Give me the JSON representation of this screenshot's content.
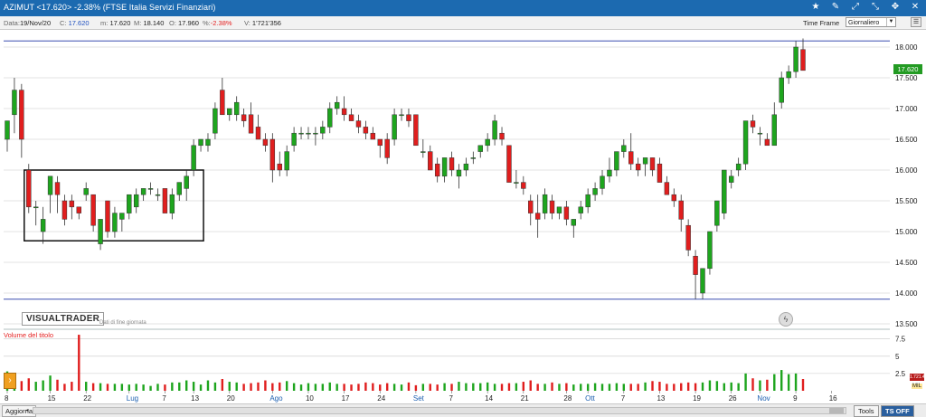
{
  "window": {
    "title": "AZIMUT <17.620> -2.38%  (FTSE Italia Servizi Finanziari)",
    "icons": [
      "star-icon",
      "settings-icon",
      "expand-icon",
      "collapse-icon",
      "move-icon",
      "close-icon"
    ]
  },
  "quote": {
    "date_label": "Data:",
    "date": "19/Nov/20",
    "close_label": "C:",
    "close": "17.620",
    "min_label": "m:",
    "min": "17.620",
    "max_label": "M:",
    "max": "18.140",
    "open_label": "O:",
    "open": "17.960",
    "pct_label": "%:",
    "pct": "-2.38%",
    "vol_label": "V:",
    "vol": "1'721'356"
  },
  "timeframe": {
    "label": "Time Frame",
    "value": "Giornaliero",
    "icon": "menu-icon"
  },
  "chart": {
    "watermark": "VISUALTRADER",
    "watermark_sub": "Dati di fine giornata",
    "volume_label": "Volume del titolo",
    "price_tag": "17.620",
    "vol_tag": "1.721.4",
    "vol_unit": "MIL",
    "flash_icon": "lightning-icon"
  },
  "chart_data": {
    "type": "candlestick",
    "title": "AZIMUT",
    "ylim": [
      13.5,
      18.2
    ],
    "y_ticks": [
      "18.000",
      "17.500",
      "17.000",
      "16.500",
      "16.000",
      "15.500",
      "15.000",
      "14.500",
      "14.000",
      "13.500"
    ],
    "vol_ticks": [
      "7.5",
      "5",
      "2.5"
    ],
    "x_labels": [
      "8",
      "15",
      "22",
      "Lug",
      "7",
      "13",
      "20",
      "Ago",
      "10",
      "17",
      "24",
      "Set",
      "7",
      "14",
      "21",
      "28",
      "Ott",
      "7",
      "13",
      "19",
      "26",
      "Nov",
      "9",
      "16"
    ],
    "hlines": [
      18.1,
      13.9
    ],
    "candles": [
      {
        "o": 16.5,
        "h": 16.8,
        "l": 16.3,
        "c": 16.8
      },
      {
        "o": 16.9,
        "h": 17.5,
        "l": 16.6,
        "c": 17.3
      },
      {
        "o": 17.3,
        "h": 17.4,
        "l": 16.2,
        "c": 16.5
      },
      {
        "o": 16.0,
        "h": 16.1,
        "l": 15.3,
        "c": 15.4
      },
      {
        "o": 15.4,
        "h": 15.5,
        "l": 15.1,
        "c": 15.4
      },
      {
        "o": 15.0,
        "h": 15.4,
        "l": 14.8,
        "c": 15.2
      },
      {
        "o": 15.6,
        "h": 15.9,
        "l": 15.3,
        "c": 15.9
      },
      {
        "o": 15.8,
        "h": 15.9,
        "l": 15.3,
        "c": 15.6
      },
      {
        "o": 15.5,
        "h": 15.6,
        "l": 15.1,
        "c": 15.2
      },
      {
        "o": 15.5,
        "h": 15.6,
        "l": 15.2,
        "c": 15.4
      },
      {
        "o": 15.4,
        "h": 15.4,
        "l": 15.2,
        "c": 15.3
      },
      {
        "o": 15.6,
        "h": 15.8,
        "l": 15.5,
        "c": 15.7
      },
      {
        "o": 15.6,
        "h": 15.6,
        "l": 15.0,
        "c": 15.1
      },
      {
        "o": 14.8,
        "h": 15.2,
        "l": 14.7,
        "c": 15.2
      },
      {
        "o": 15.5,
        "h": 15.5,
        "l": 14.9,
        "c": 15.0
      },
      {
        "o": 15.0,
        "h": 15.4,
        "l": 14.9,
        "c": 15.3
      },
      {
        "o": 15.2,
        "h": 15.3,
        "l": 15.0,
        "c": 15.3
      },
      {
        "o": 15.3,
        "h": 15.6,
        "l": 15.2,
        "c": 15.6
      },
      {
        "o": 15.4,
        "h": 15.7,
        "l": 15.3,
        "c": 15.6
      },
      {
        "o": 15.6,
        "h": 15.7,
        "l": 15.5,
        "c": 15.7
      },
      {
        "o": 15.7,
        "h": 15.8,
        "l": 15.6,
        "c": 15.7
      },
      {
        "o": 15.6,
        "h": 15.7,
        "l": 15.5,
        "c": 15.6
      },
      {
        "o": 15.7,
        "h": 15.7,
        "l": 15.3,
        "c": 15.3
      },
      {
        "o": 15.3,
        "h": 15.7,
        "l": 15.2,
        "c": 15.6
      },
      {
        "o": 15.6,
        "h": 15.8,
        "l": 15.5,
        "c": 15.8
      },
      {
        "o": 15.7,
        "h": 16.0,
        "l": 15.5,
        "c": 15.9
      },
      {
        "o": 16.0,
        "h": 16.5,
        "l": 15.9,
        "c": 16.4
      },
      {
        "o": 16.4,
        "h": 16.5,
        "l": 16.3,
        "c": 16.5
      },
      {
        "o": 16.4,
        "h": 16.6,
        "l": 16.3,
        "c": 16.5
      },
      {
        "o": 16.6,
        "h": 17.1,
        "l": 16.5,
        "c": 17.0
      },
      {
        "o": 17.3,
        "h": 17.5,
        "l": 16.9,
        "c": 16.9
      },
      {
        "o": 16.9,
        "h": 17.0,
        "l": 16.8,
        "c": 17.0
      },
      {
        "o": 16.9,
        "h": 17.2,
        "l": 16.8,
        "c": 17.1
      },
      {
        "o": 16.9,
        "h": 17.0,
        "l": 16.7,
        "c": 16.8
      },
      {
        "o": 16.9,
        "h": 17.1,
        "l": 16.6,
        "c": 16.6
      },
      {
        "o": 16.7,
        "h": 16.9,
        "l": 16.5,
        "c": 16.5
      },
      {
        "o": 16.5,
        "h": 16.6,
        "l": 16.3,
        "c": 16.4
      },
      {
        "o": 16.5,
        "h": 16.6,
        "l": 15.8,
        "c": 16.0
      },
      {
        "o": 16.1,
        "h": 16.3,
        "l": 15.9,
        "c": 16.0
      },
      {
        "o": 16.0,
        "h": 16.4,
        "l": 15.9,
        "c": 16.3
      },
      {
        "o": 16.4,
        "h": 16.7,
        "l": 16.3,
        "c": 16.6
      },
      {
        "o": 16.6,
        "h": 16.7,
        "l": 16.5,
        "c": 16.6
      },
      {
        "o": 16.6,
        "h": 16.7,
        "l": 16.5,
        "c": 16.6
      },
      {
        "o": 16.6,
        "h": 16.7,
        "l": 16.4,
        "c": 16.6
      },
      {
        "o": 16.6,
        "h": 16.8,
        "l": 16.5,
        "c": 16.7
      },
      {
        "o": 16.7,
        "h": 17.1,
        "l": 16.6,
        "c": 17.0
      },
      {
        "o": 17.0,
        "h": 17.2,
        "l": 16.9,
        "c": 17.1
      },
      {
        "o": 17.0,
        "h": 17.2,
        "l": 16.8,
        "c": 16.9
      },
      {
        "o": 16.9,
        "h": 17.0,
        "l": 16.8,
        "c": 16.8
      },
      {
        "o": 16.8,
        "h": 16.9,
        "l": 16.6,
        "c": 16.7
      },
      {
        "o": 16.7,
        "h": 16.8,
        "l": 16.5,
        "c": 16.6
      },
      {
        "o": 16.6,
        "h": 16.7,
        "l": 16.5,
        "c": 16.5
      },
      {
        "o": 16.5,
        "h": 16.5,
        "l": 16.2,
        "c": 16.4
      },
      {
        "o": 16.5,
        "h": 16.6,
        "l": 16.1,
        "c": 16.2
      },
      {
        "o": 16.5,
        "h": 17.0,
        "l": 16.4,
        "c": 16.9
      },
      {
        "o": 16.9,
        "h": 17.0,
        "l": 16.8,
        "c": 16.9
      },
      {
        "o": 16.9,
        "h": 17.0,
        "l": 16.7,
        "c": 16.8
      },
      {
        "o": 16.9,
        "h": 16.9,
        "l": 16.4,
        "c": 16.4
      },
      {
        "o": 16.3,
        "h": 16.5,
        "l": 16.2,
        "c": 16.3
      },
      {
        "o": 16.3,
        "h": 16.4,
        "l": 16.0,
        "c": 16.0
      },
      {
        "o": 16.1,
        "h": 16.2,
        "l": 15.8,
        "c": 15.9
      },
      {
        "o": 15.9,
        "h": 16.2,
        "l": 15.8,
        "c": 16.2
      },
      {
        "o": 16.2,
        "h": 16.3,
        "l": 15.9,
        "c": 16.0
      },
      {
        "o": 15.9,
        "h": 16.1,
        "l": 15.7,
        "c": 16.0
      },
      {
        "o": 16.0,
        "h": 16.2,
        "l": 15.9,
        "c": 16.1
      },
      {
        "o": 16.2,
        "h": 16.3,
        "l": 16.1,
        "c": 16.2
      },
      {
        "o": 16.3,
        "h": 16.4,
        "l": 16.2,
        "c": 16.4
      },
      {
        "o": 16.4,
        "h": 16.6,
        "l": 16.3,
        "c": 16.5
      },
      {
        "o": 16.5,
        "h": 16.9,
        "l": 16.4,
        "c": 16.8
      },
      {
        "o": 16.6,
        "h": 16.7,
        "l": 16.4,
        "c": 16.5
      },
      {
        "o": 16.4,
        "h": 16.4,
        "l": 15.8,
        "c": 15.8
      },
      {
        "o": 15.8,
        "h": 16.0,
        "l": 15.7,
        "c": 15.8
      },
      {
        "o": 15.8,
        "h": 15.9,
        "l": 15.6,
        "c": 15.7
      },
      {
        "o": 15.5,
        "h": 15.6,
        "l": 15.1,
        "c": 15.3
      },
      {
        "o": 15.3,
        "h": 15.6,
        "l": 14.9,
        "c": 15.2
      },
      {
        "o": 15.3,
        "h": 15.7,
        "l": 15.2,
        "c": 15.6
      },
      {
        "o": 15.5,
        "h": 15.6,
        "l": 15.2,
        "c": 15.3
      },
      {
        "o": 15.3,
        "h": 15.4,
        "l": 15.2,
        "c": 15.4
      },
      {
        "o": 15.4,
        "h": 15.5,
        "l": 15.1,
        "c": 15.2
      },
      {
        "o": 15.1,
        "h": 15.2,
        "l": 14.9,
        "c": 15.2
      },
      {
        "o": 15.3,
        "h": 15.5,
        "l": 15.2,
        "c": 15.4
      },
      {
        "o": 15.4,
        "h": 15.7,
        "l": 15.3,
        "c": 15.6
      },
      {
        "o": 15.6,
        "h": 15.8,
        "l": 15.5,
        "c": 15.7
      },
      {
        "o": 15.7,
        "h": 16.0,
        "l": 15.6,
        "c": 15.9
      },
      {
        "o": 15.9,
        "h": 16.2,
        "l": 15.8,
        "c": 16.0
      },
      {
        "o": 16.0,
        "h": 16.3,
        "l": 15.9,
        "c": 16.3
      },
      {
        "o": 16.3,
        "h": 16.5,
        "l": 16.2,
        "c": 16.4
      },
      {
        "o": 16.3,
        "h": 16.6,
        "l": 16.0,
        "c": 16.1
      },
      {
        "o": 16.1,
        "h": 16.2,
        "l": 15.9,
        "c": 16.0
      },
      {
        "o": 16.1,
        "h": 16.2,
        "l": 15.9,
        "c": 16.2
      },
      {
        "o": 16.2,
        "h": 16.2,
        "l": 15.9,
        "c": 16.0
      },
      {
        "o": 16.1,
        "h": 16.2,
        "l": 15.8,
        "c": 15.8
      },
      {
        "o": 15.8,
        "h": 15.9,
        "l": 15.6,
        "c": 15.6
      },
      {
        "o": 15.6,
        "h": 15.7,
        "l": 15.4,
        "c": 15.5
      },
      {
        "o": 15.5,
        "h": 15.6,
        "l": 15.0,
        "c": 15.2
      },
      {
        "o": 15.1,
        "h": 15.2,
        "l": 14.6,
        "c": 14.7
      },
      {
        "o": 14.6,
        "h": 14.7,
        "l": 13.9,
        "c": 14.3
      },
      {
        "o": 14.0,
        "h": 14.4,
        "l": 13.9,
        "c": 14.4
      },
      {
        "o": 14.4,
        "h": 15.0,
        "l": 14.3,
        "c": 15.0
      },
      {
        "o": 15.1,
        "h": 15.5,
        "l": 15.0,
        "c": 15.5
      },
      {
        "o": 15.3,
        "h": 16.0,
        "l": 15.2,
        "c": 16.0
      },
      {
        "o": 15.8,
        "h": 16.0,
        "l": 15.7,
        "c": 15.9
      },
      {
        "o": 16.0,
        "h": 16.2,
        "l": 15.9,
        "c": 16.1
      },
      {
        "o": 16.1,
        "h": 16.8,
        "l": 16.0,
        "c": 16.8
      },
      {
        "o": 16.8,
        "h": 16.9,
        "l": 16.6,
        "c": 16.7
      },
      {
        "o": 16.6,
        "h": 16.7,
        "l": 16.4,
        "c": 16.6
      },
      {
        "o": 16.5,
        "h": 16.6,
        "l": 16.4,
        "c": 16.4
      },
      {
        "o": 16.4,
        "h": 17.1,
        "l": 16.4,
        "c": 16.9
      },
      {
        "o": 17.1,
        "h": 17.6,
        "l": 17.0,
        "c": 17.5
      },
      {
        "o": 17.5,
        "h": 17.7,
        "l": 17.4,
        "c": 17.6
      },
      {
        "o": 17.6,
        "h": 18.1,
        "l": 17.5,
        "c": 18.0
      },
      {
        "o": 17.96,
        "h": 18.14,
        "l": 17.62,
        "c": 17.62
      }
    ],
    "volumes": [
      2.8,
      2.5,
      1.4,
      1.8,
      1.3,
      1.5,
      2.2,
      1.6,
      1.0,
      1.3,
      8.1,
      1.3,
      1.1,
      1.1,
      1.0,
      1.0,
      1.0,
      0.9,
      1.0,
      0.9,
      0.7,
      1.0,
      0.9,
      1.2,
      1.2,
      1.5,
      1.3,
      0.9,
      1.5,
      1.2,
      1.7,
      1.3,
      1.2,
      1.0,
      1.1,
      1.2,
      1.5,
      1.1,
      1.2,
      1.4,
      1.1,
      0.9,
      1.1,
      1.0,
      1.0,
      1.2,
      1.0,
      1.0,
      0.9,
      1.0,
      1.2,
      1.1,
      0.9,
      1.1,
      1.0,
      0.9,
      1.2,
      0.8,
      1.0,
      1.0,
      0.9,
      1.1,
      1.0,
      1.3,
      1.1,
      1.1,
      1.1,
      1.2,
      1.0,
      1.0,
      1.1,
      1.1,
      1.3,
      1.5,
      1.0,
      1.0,
      1.2,
      1.0,
      1.1,
      0.9,
      1.0,
      1.0,
      1.1,
      1.0,
      1.0,
      1.1,
      1.0,
      1.0,
      1.0,
      1.2,
      1.4,
      1.3,
      1.0,
      1.0,
      1.1,
      1.2,
      1.1,
      1.2,
      1.5,
      1.4,
      1.1,
      1.2,
      1.1,
      2.5,
      1.8,
      1.5,
      1.6,
      2.4,
      3.0,
      2.4,
      2.5,
      1.7
    ]
  },
  "footer": {
    "aggiorna": "Aggiorna",
    "tools": "Tools",
    "tsoff": "TS OFF"
  },
  "colors": {
    "up": "#1ea51e",
    "down": "#e01e1e",
    "titlebar": "#1c6ab0",
    "grid": "#c8c8c8",
    "hline": "#3a4fb0"
  }
}
